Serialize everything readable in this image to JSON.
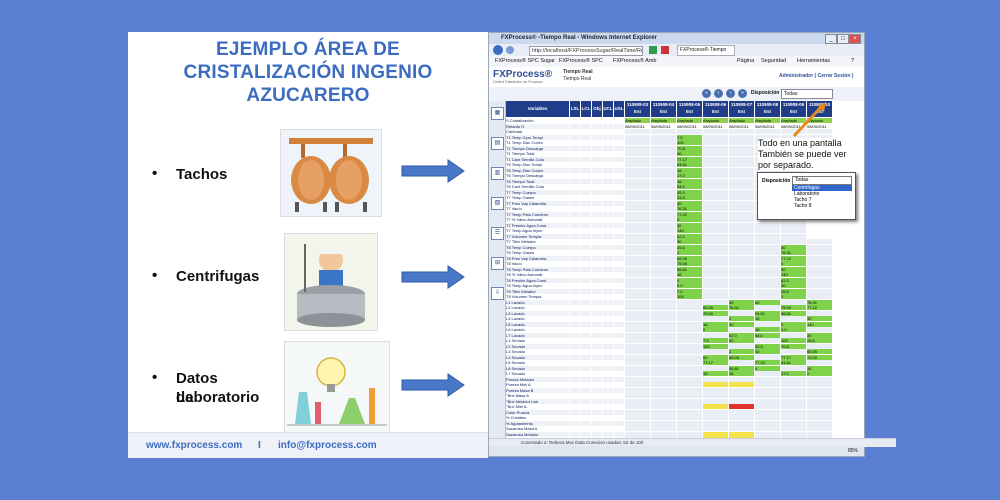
{
  "slide": {
    "title_lines": [
      "EJEMPLO ÁREA DE",
      "CRISTALIZACIÓN INGENIO",
      "AZUCARERO"
    ],
    "bullets": [
      {
        "symbol": "•",
        "lines": [
          "Tachos"
        ],
        "icon": "tanks-illustration-icon"
      },
      {
        "symbol": "•",
        "lines": [
          "Centrifugas"
        ],
        "icon": "centrifuge-worker-icon"
      },
      {
        "symbol": "•",
        "lines": [
          "Datos de",
          "Laboratorio"
        ],
        "icon": "laboratory-flasks-icon"
      }
    ],
    "footer": {
      "website": "www.fxprocess.com",
      "separator": "I",
      "email": "info@fxprocess.com"
    },
    "colors": {
      "background": "#5b7fd3",
      "title": "#3c6cc0",
      "arrow": "#4a78c8"
    }
  },
  "browser": {
    "title": "FXProcess® -Tiempo Real - Windows Internet Explorer",
    "address": "http://localhost/FXProcessSugar/RealTime/Real",
    "tab": "FXProcess®-Tiempo Real",
    "favorites": [
      "FXProcess® SPC Sugar",
      "FXProcess® SPC",
      "FXProcess® Amb"
    ],
    "ie_menu": [
      "Página",
      "Seguridad",
      "Herramientas",
      "?"
    ],
    "app": {
      "logo": "FXProcess®",
      "logo_sub": "Control Estadístico de Procesos",
      "section": "Tiempo Real",
      "subsection": "Tiempo Real",
      "user": "Administrador ( Cerrar Sesión )",
      "disposition_label": "Disposición",
      "disposition_value": "Todas"
    },
    "grid": {
      "headers": [
        "Variables",
        "LSL",
        "LCL",
        "Obj",
        "UCL",
        "USL"
      ],
      "tachos": [
        {
          "code": "110908-03",
          "state": "Est",
          "date": "08/09/2011",
          "status": "Arepiado"
        },
        {
          "code": "110908-04",
          "state": "Est",
          "date": "08/09/2011",
          "status": "Arepiado"
        },
        {
          "code": "110908-05",
          "state": "Est",
          "date": "08/09/2011",
          "status": "Arepiado"
        },
        {
          "code": "110908-06",
          "state": "Est",
          "date": "08/09/2011",
          "status": "Arepiado"
        },
        {
          "code": "110908-07",
          "state": "Est",
          "date": "08/09/2011",
          "status": "Arepiado"
        },
        {
          "code": "110908-08",
          "state": "Est",
          "date": "08/09/2011",
          "status": "Arepiado"
        },
        {
          "code": "110908-09",
          "state": "Est",
          "date": "08/09/2011",
          "status": "Arepiado"
        },
        {
          "code": "110908-10",
          "state": "Est",
          "date": "08/09/2011",
          "status": "Arepiado"
        }
      ],
      "variables": [
        "S.Cristalización",
        "Retardo H",
        "Cantidad",
        "T1 Temp Gyro Tempi",
        "T1 Temp Disc Cocim",
        "T1 Tiempo Descarga",
        "T1 Tiempo Total",
        "T1 Cant Semilla Cola",
        "T6 Temp Disc Tempi",
        "T6 Temp Disc Cocim",
        "T6 Tiempo Descarga",
        "T6 Tiempo Total",
        "T6 Cant Semilla Cola",
        "T7 Temp Cuerpo",
        "T7 Temp Gases",
        "T7 Pres Vap Calandria",
        "T7 Vacío",
        "T7 Temp Pata Condens",
        "T7 % Válvu Automát",
        "T7 Presión Agua Cond",
        "T7 Temp Agua Inyec",
        "T7 Volumen Templa",
        "T7 °Brix Melador",
        "T8 Temp Cuerpo",
        "T8 Temp Gases",
        "T8 Pres Vap Calandria",
        "T8 Vacío",
        "T8 Temp Pata Condens",
        "T8 % Válvu Automát",
        "T8 Presión Agua Cond",
        "T8 Temp Agua Inyec",
        "T8 °Brix Melador",
        "T8 Volumen Templa",
        "L1 Lavado",
        "L2 Lavado",
        "L3 Lavado",
        "L4 Lavado",
        "L5 Lavado",
        "L6 Lavado",
        "L7 Lavado",
        "L1 Secado",
        "L2 Secado",
        "L3 Secado",
        "L4 Secado",
        "L5 Secado",
        "L6 Secado",
        "L7 Secado",
        "Pureza Melador",
        "Pureza Miel A",
        "Pureza Masa B",
        "°Brix Masa A",
        "°Brix Melador Lab",
        "°Brix Miel A",
        "Color Pureza",
        "% Cristales",
        "% Agotamiento",
        "Sacarosa Masa A",
        "Sacarosa Melador",
        "Sacarosa Miel A"
      ],
      "sample_values": [
        "0",
        "15",
        "16",
        "30",
        "17.0",
        "0",
        "140",
        "16",
        "0.0",
        "62.0",
        "54.0",
        "7.0",
        "30",
        "45.3",
        "100",
        "26.6",
        "33.5",
        "70.8",
        "1",
        "40",
        "60",
        "65.05",
        "76.31",
        "77.17",
        "75.00",
        "77.22",
        "54.61",
        "56.81"
      ]
    },
    "status_text": "Conectado a: Rebeca Mvc Data Conexion usadas: 52 de 100",
    "zoom": "85%",
    "callout_lines": [
      "Todo en una pantalla",
      "También se puede ver",
      "por separado."
    ],
    "popup": {
      "label": "Disposición",
      "selected": "Todas",
      "options": [
        "Centrifugas",
        "Laboratorio",
        "Tacho 7",
        "Tacho 8"
      ]
    }
  }
}
